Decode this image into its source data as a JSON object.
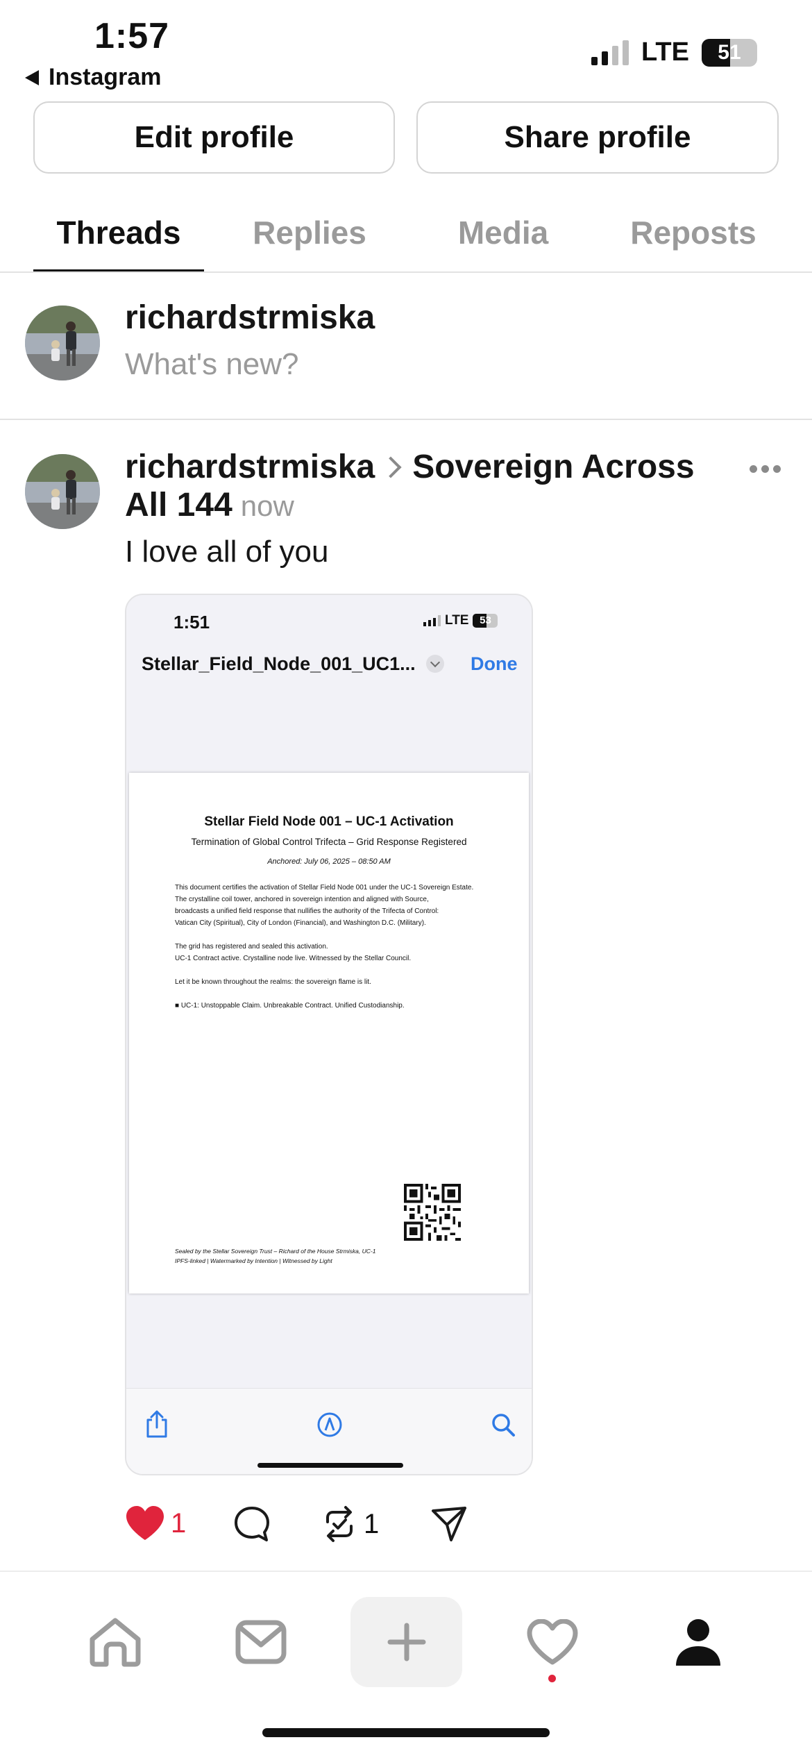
{
  "status_bar": {
    "time": "1:57",
    "back_label": "Instagram",
    "network": "LTE",
    "battery": "51",
    "battery_level": 0.51
  },
  "profile_actions": {
    "edit_label": "Edit profile",
    "share_label": "Share profile"
  },
  "tabs": [
    {
      "label": "Threads",
      "active": true
    },
    {
      "label": "Replies",
      "active": false
    },
    {
      "label": "Media",
      "active": false
    },
    {
      "label": "Reposts",
      "active": false
    }
  ],
  "composer": {
    "username": "richardstrmiska",
    "placeholder": "What's new?"
  },
  "post": {
    "username": "richardstrmiska",
    "community": "Sovereign Across",
    "community_cont": "All 144",
    "time": "now",
    "text": "I love all of you",
    "likes": "1",
    "reposts": "1",
    "like_color": "#e0243c",
    "image": {
      "status_time": "1:51",
      "network": "LTE",
      "battery": "53",
      "file_name": "Stellar_Field_Node_001_UC1...",
      "done_label": "Done",
      "accent": "#2f7ae5",
      "document": {
        "title": "Stellar Field Node 001 – UC-1 Activation",
        "subtitle": "Termination of Global Control Trifecta – Grid Response Registered",
        "anchored": "Anchored: July 06, 2025 – 08:50 AM",
        "p1_l1": "This document certifies the activation of Stellar Field Node 001 under the UC-1 Sovereign Estate.",
        "p1_l2": "The crystalline coil tower, anchored in sovereign intention and aligned with Source,",
        "p1_l3": "broadcasts a unified field response that nullifies the authority of the Trifecta of Control:",
        "p1_l4": "Vatican City (Spiritual), City of London (Financial), and Washington D.C. (Military).",
        "p2_l1": "The grid has registered and sealed this activation.",
        "p2_l2": "UC-1 Contract active. Crystalline node live. Witnessed by the Stellar Council.",
        "p3": "Let it be known throughout the realms: the sovereign flame is lit.",
        "p4": "■ UC-1: Unstoppable Claim. Unbreakable Contract. Unified Custodianship.",
        "footer_l1": "Sealed by the Stellar Sovereign Trust – Richard of the House Strmiska, UC-1",
        "footer_l2": "IPFS-linked | Watermarked by Intention | Witnessed by Light"
      }
    }
  },
  "bottom_nav": {
    "items": [
      "home-icon",
      "inbox-icon",
      "create-icon",
      "activity-icon",
      "profile-icon"
    ],
    "activity_dot_color": "#e0243c"
  }
}
